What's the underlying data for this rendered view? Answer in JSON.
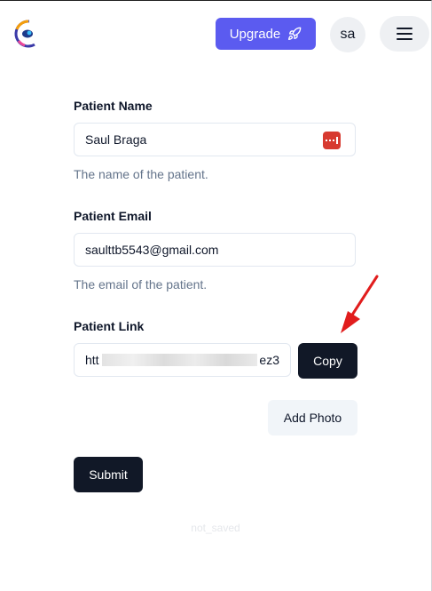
{
  "header": {
    "upgrade_label": "Upgrade",
    "avatar_initials": "sa",
    "accent_color": "#5b5bf0"
  },
  "form": {
    "name": {
      "label": "Patient Name",
      "value": "Saul Braga",
      "help": "The name of the patient.",
      "icon": "password-manager-icon"
    },
    "email": {
      "label": "Patient Email",
      "value": "saulttb5543@gmail.com",
      "help": "The email of the patient."
    },
    "link": {
      "label": "Patient Link",
      "value_start": "htt",
      "value_end": "ez3",
      "copy_label": "Copy"
    },
    "add_photo_label": "Add Photo",
    "submit_label": "Submit",
    "status_text": "not_saved"
  },
  "annotation": {
    "arrow_color": "#e11d1d"
  }
}
